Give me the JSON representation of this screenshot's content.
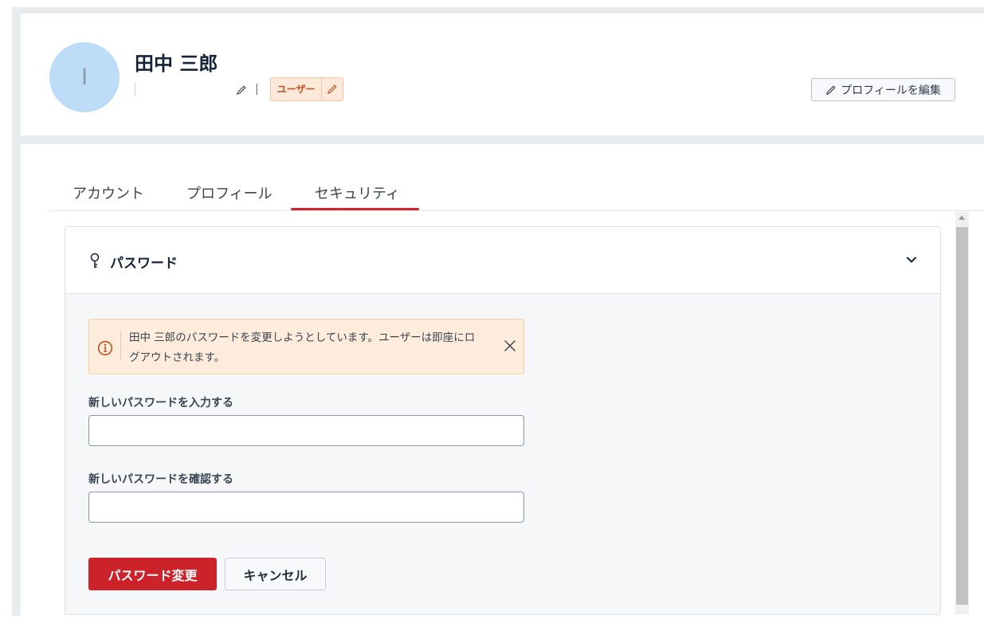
{
  "user": {
    "avatar_initial": "I",
    "name": "田中 三郎",
    "separator": "|",
    "role": "ユーザー"
  },
  "header": {
    "edit_profile_label": "プロフィールを編集"
  },
  "tabs": [
    {
      "label": "アカウント"
    },
    {
      "label": "プロフィール"
    },
    {
      "label": "セキュリティ",
      "active": true
    }
  ],
  "password_panel": {
    "title": "パスワード",
    "alert_text": "田中 三郎のパスワードを変更しようとしています。ユーザーは即座にログアウトされます。",
    "new_password_label": "新しいパスワードを入力する",
    "new_password_value": "",
    "confirm_password_label": "新しいパスワードを確認する",
    "confirm_password_value": "",
    "submit_label": "パスワード変更",
    "cancel_label": "キャンセル"
  },
  "colors": {
    "accent": "#cc2229",
    "badge_bg": "#fde9d9",
    "alert_bg": "#fdecdc",
    "avatar_bg": "#bcdcf7"
  },
  "icons": [
    "pencil-icon",
    "key-icon",
    "chevron-down-icon",
    "info-icon",
    "close-icon"
  ]
}
